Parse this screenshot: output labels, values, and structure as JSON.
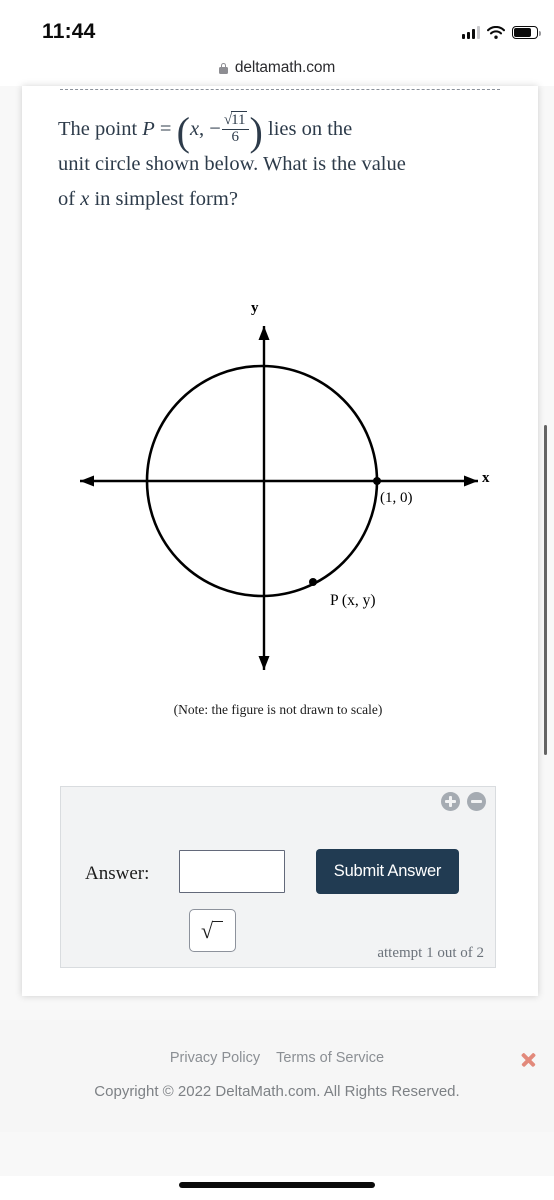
{
  "status_bar": {
    "time": "11:44",
    "signal_icon": "cellular-signal-icon",
    "wifi_icon": "wifi-icon",
    "battery_icon": "battery-icon"
  },
  "browser": {
    "lock_icon": "lock-icon",
    "url": "deltamath.com"
  },
  "question": {
    "lead": "The point ",
    "var_p": "P",
    "equals": " = ",
    "open_paren": "(",
    "var_x": "x",
    "comma": ",",
    "minus": "−",
    "radical_symbol": "√",
    "radicand": "11",
    "denominator": "6",
    "close_paren": ")",
    "tail_line1": " lies on the",
    "line2": "unit circle shown below. What is the value",
    "line3_a": "of ",
    "line3_var": "x",
    "line3_b": " in simplest form?"
  },
  "figure": {
    "y_axis_label": "y",
    "x_axis_label": "x",
    "point_on_axis_label": "(1, 0)",
    "point_p_label": "P (x, y)",
    "note": "(Note: the figure is not drawn to scale)",
    "circle_color": "#000000"
  },
  "answer_panel": {
    "zoom_in_icon": "plus-circle-icon",
    "zoom_out_icon": "minus-circle-icon",
    "answer_label": "Answer:",
    "answer_value": "",
    "answer_placeholder": "",
    "submit_label": "Submit Answer",
    "submit_color": "#213b52",
    "sqrt_key_label": "√",
    "attempt_text": "attempt 1 out of 2"
  },
  "footer": {
    "privacy_policy": "Privacy Policy",
    "terms_of_service": "Terms of Service",
    "copyright": "Copyright © 2022 DeltaMath.com. All Rights Reserved.",
    "close_icon": "close-x-icon",
    "close_color": "#e2897b"
  }
}
